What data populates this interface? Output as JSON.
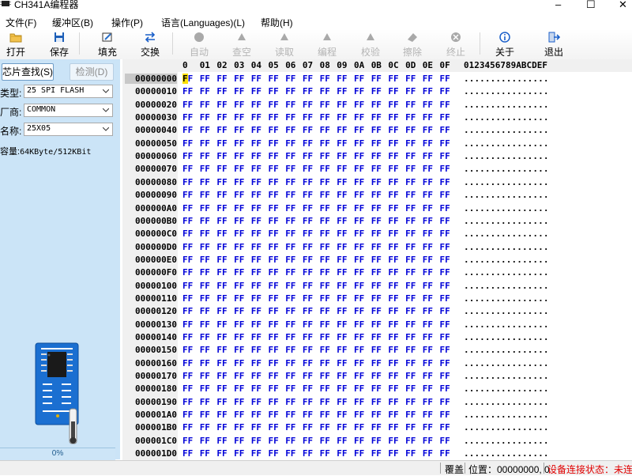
{
  "window": {
    "title": "CH341A编程器",
    "min": "–",
    "max": "☐",
    "close": "✕"
  },
  "menu": [
    "文件(F)",
    "缓冲区(B)",
    "操作(P)",
    "语言(Languages)(L)",
    "帮助(H)"
  ],
  "toolbar": {
    "open": "打开",
    "save": "保存",
    "fill": "填充",
    "swap": "交换",
    "auto": "自动",
    "blank": "查空",
    "read": "读取",
    "program": "编程",
    "verify": "校验",
    "erase": "擦除",
    "stop": "终止",
    "about": "关于",
    "exit": "退出"
  },
  "left": {
    "tab_find": "芯片查找(S)",
    "tab_detect": "检测(D)",
    "type_label": "类型:",
    "type_value": "25 SPI FLASH",
    "vendor_label": "厂商:",
    "vendor_value": "COMMON",
    "name_label": "名称:",
    "name_value": "25X05",
    "capacity_label": "容量:",
    "capacity_value": "64KByte/512KBit",
    "progress": "0%",
    "progress_value": 0
  },
  "hex": {
    "headers": [
      "0",
      "01",
      "02",
      "03",
      "04",
      "05",
      "06",
      "07",
      "08",
      "09",
      "0A",
      "0B",
      "0C",
      "0D",
      "0E",
      "0F"
    ],
    "ascii_header": "0123456789ABCDEF",
    "rows": [
      {
        "addr": "00000000",
        "ascii": "................"
      },
      {
        "addr": "00000010",
        "ascii": "................"
      },
      {
        "addr": "00000020",
        "ascii": "................"
      },
      {
        "addr": "00000030",
        "ascii": "................"
      },
      {
        "addr": "00000040",
        "ascii": "................"
      },
      {
        "addr": "00000050",
        "ascii": "................"
      },
      {
        "addr": "00000060",
        "ascii": "................"
      },
      {
        "addr": "00000070",
        "ascii": "................"
      },
      {
        "addr": "00000080",
        "ascii": "................"
      },
      {
        "addr": "00000090",
        "ascii": "................"
      },
      {
        "addr": "000000A0",
        "ascii": "................"
      },
      {
        "addr": "000000B0",
        "ascii": "................"
      },
      {
        "addr": "000000C0",
        "ascii": "................"
      },
      {
        "addr": "000000D0",
        "ascii": "................"
      },
      {
        "addr": "000000E0",
        "ascii": "................"
      },
      {
        "addr": "000000F0",
        "ascii": "................"
      },
      {
        "addr": "00000100",
        "ascii": "................"
      },
      {
        "addr": "00000110",
        "ascii": "................"
      },
      {
        "addr": "00000120",
        "ascii": "................"
      },
      {
        "addr": "00000130",
        "ascii": "................"
      },
      {
        "addr": "00000140",
        "ascii": "................"
      },
      {
        "addr": "00000150",
        "ascii": "................"
      },
      {
        "addr": "00000160",
        "ascii": "................"
      },
      {
        "addr": "00000170",
        "ascii": "................"
      },
      {
        "addr": "00000180",
        "ascii": "................"
      },
      {
        "addr": "00000190",
        "ascii": "................"
      },
      {
        "addr": "000001A0",
        "ascii": "................"
      },
      {
        "addr": "000001B0",
        "ascii": "................"
      },
      {
        "addr": "000001C0",
        "ascii": "................"
      },
      {
        "addr": "000001D0",
        "ascii": "................"
      }
    ],
    "byte_value": "FF",
    "cursor_char": "F"
  },
  "status": {
    "mode": "覆盖",
    "position": "位置：00000000, 0",
    "connection": "设备连接状态：未连接"
  },
  "colors": {
    "hex_text": "#0000d8",
    "cursor": "#ffe000",
    "panel": "#cbe4f7",
    "warning": "#e00000"
  },
  "icons": {
    "open": "folder-icon",
    "save": "floppy-icon",
    "fill": "edit-icon",
    "swap": "swap-arrows-icon",
    "about": "info-icon",
    "exit": "exit-door-icon"
  }
}
